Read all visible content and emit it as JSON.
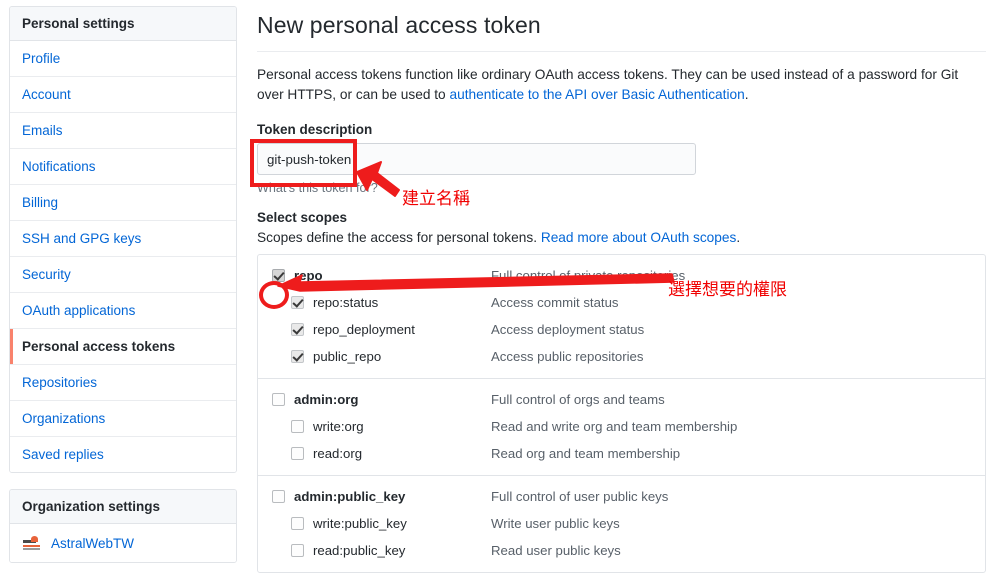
{
  "sidebar": {
    "personal": {
      "heading": "Personal settings",
      "items": [
        {
          "label": "Profile",
          "selected": false
        },
        {
          "label": "Account",
          "selected": false
        },
        {
          "label": "Emails",
          "selected": false
        },
        {
          "label": "Notifications",
          "selected": false
        },
        {
          "label": "Billing",
          "selected": false
        },
        {
          "label": "SSH and GPG keys",
          "selected": false
        },
        {
          "label": "Security",
          "selected": false
        },
        {
          "label": "OAuth applications",
          "selected": false
        },
        {
          "label": "Personal access tokens",
          "selected": true
        },
        {
          "label": "Repositories",
          "selected": false
        },
        {
          "label": "Organizations",
          "selected": false
        },
        {
          "label": "Saved replies",
          "selected": false
        }
      ]
    },
    "organization": {
      "heading": "Organization settings",
      "items": [
        {
          "label": "AstralWebTW",
          "avatar": "org-logo-icon"
        }
      ]
    }
  },
  "main": {
    "title": "New personal access token",
    "intro_before": "Personal access tokens function like ordinary OAuth access tokens. They can be used instead of a password for Git over HTTPS, or can be used to ",
    "intro_link": "authenticate to the API over Basic Authentication",
    "intro_after": ".",
    "token_description_label": "Token description",
    "token_description_value": "git-push-token",
    "token_description_placeholder": "What's this token for?",
    "token_description_hint": "What's this token for?",
    "select_scopes_label": "Select scopes",
    "scopes_desc_before": "Scopes define the access for personal tokens. ",
    "scopes_desc_link": "Read more about OAuth scopes",
    "scopes_desc_after": ".",
    "scope_groups": [
      {
        "rows": [
          {
            "name": "repo",
            "desc": "Full control of private repositories",
            "level": "parent",
            "checked": true,
            "disabled": false
          },
          {
            "name": "repo:status",
            "desc": "Access commit status",
            "level": "child",
            "checked": true,
            "disabled": true
          },
          {
            "name": "repo_deployment",
            "desc": "Access deployment status",
            "level": "child",
            "checked": true,
            "disabled": true
          },
          {
            "name": "public_repo",
            "desc": "Access public repositories",
            "level": "child",
            "checked": true,
            "disabled": true
          }
        ]
      },
      {
        "rows": [
          {
            "name": "admin:org",
            "desc": "Full control of orgs and teams",
            "level": "parent",
            "checked": false,
            "disabled": false
          },
          {
            "name": "write:org",
            "desc": "Read and write org and team membership",
            "level": "child",
            "checked": false,
            "disabled": false
          },
          {
            "name": "read:org",
            "desc": "Read org and team membership",
            "level": "child",
            "checked": false,
            "disabled": false
          }
        ]
      },
      {
        "rows": [
          {
            "name": "admin:public_key",
            "desc": "Full control of user public keys",
            "level": "parent",
            "checked": false,
            "disabled": false
          },
          {
            "name": "write:public_key",
            "desc": "Write user public keys",
            "level": "child",
            "checked": false,
            "disabled": false
          },
          {
            "name": "read:public_key",
            "desc": "Read user public keys",
            "level": "child",
            "checked": false,
            "disabled": false
          }
        ]
      }
    ]
  },
  "annotations": {
    "color": "#f00000",
    "items": [
      {
        "text": "建立名稱",
        "target": "token-description-input"
      },
      {
        "text": "選擇想要的權限",
        "target": "repo-scope-checkbox"
      }
    ]
  }
}
